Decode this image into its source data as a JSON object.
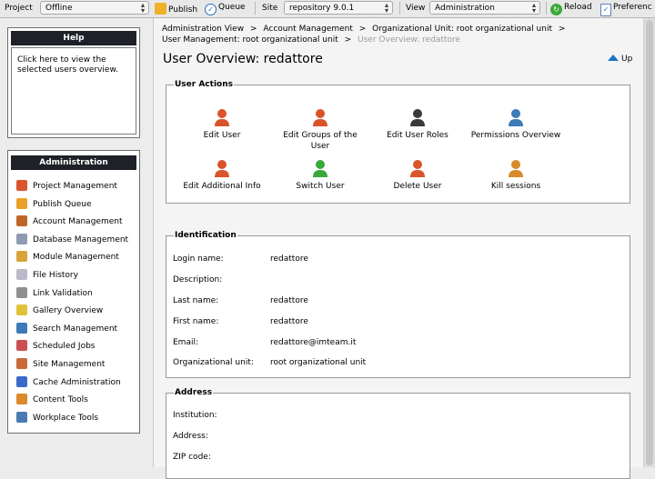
{
  "toolbar": {
    "project_label": "Project",
    "project_value": "Offline",
    "publish_label": "Publish",
    "queue_label": "Queue",
    "site_label": "Site",
    "site_value": "repository 9.0.1",
    "view_label": "View",
    "view_value": "Administration",
    "reload_label": "Reload",
    "preferences_label": "Preferenc"
  },
  "help": {
    "title": "Help",
    "text": "Click here to view the selected users overview."
  },
  "admin": {
    "title": "Administration",
    "items": [
      {
        "label": "Project Management",
        "icon": "project-management-icon",
        "color": "#d9542b"
      },
      {
        "label": "Publish Queue",
        "icon": "publish-queue-icon",
        "color": "#e8a22a"
      },
      {
        "label": "Account Management",
        "icon": "account-management-icon",
        "color": "#c0652a"
      },
      {
        "label": "Database Management",
        "icon": "database-management-icon",
        "color": "#8f9bb3"
      },
      {
        "label": "Module Management",
        "icon": "module-management-icon",
        "color": "#d9a23a"
      },
      {
        "label": "File History",
        "icon": "file-history-icon",
        "color": "#b9b9c8"
      },
      {
        "label": "Link Validation",
        "icon": "link-validation-icon",
        "color": "#8f8f8f"
      },
      {
        "label": "Gallery Overview",
        "icon": "gallery-overview-icon",
        "color": "#e0c23a"
      },
      {
        "label": "Search Management",
        "icon": "search-management-icon",
        "color": "#3d7ab8"
      },
      {
        "label": "Scheduled Jobs",
        "icon": "scheduled-jobs-icon",
        "color": "#c95050"
      },
      {
        "label": "Site Management",
        "icon": "site-management-icon",
        "color": "#c96a3a"
      },
      {
        "label": "Cache Administration",
        "icon": "cache-administration-icon",
        "color": "#3a6ac9"
      },
      {
        "label": "Content Tools",
        "icon": "content-tools-icon",
        "color": "#d98a2a"
      },
      {
        "label": "Workplace Tools",
        "icon": "workplace-tools-icon",
        "color": "#4a7ab0"
      }
    ]
  },
  "breadcrumb": {
    "items": [
      "Administration View",
      "Account Management",
      "Organizational Unit: root organizational unit",
      "User Management: root organizational unit"
    ],
    "current": "User Overview: redattore",
    "separator": ">"
  },
  "page": {
    "title": "User Overview: redattore",
    "up_label": "Up"
  },
  "user_actions": {
    "legend": "User Actions",
    "items": [
      {
        "label": "Edit User",
        "icon": "edit-user-icon"
      },
      {
        "label": "Edit Groups of the User",
        "icon": "edit-groups-icon"
      },
      {
        "label": "Edit User Roles",
        "icon": "edit-user-roles-icon"
      },
      {
        "label": "Permissions Overview",
        "icon": "permissions-overview-icon"
      },
      {
        "label": "Edit Additional Info",
        "icon": "edit-additional-info-icon"
      },
      {
        "label": "Switch User",
        "icon": "switch-user-icon"
      },
      {
        "label": "Delete User",
        "icon": "delete-user-icon"
      },
      {
        "label": "Kill sessions",
        "icon": "kill-sessions-icon"
      }
    ]
  },
  "identification": {
    "legend": "Identification",
    "fields": [
      {
        "label": "Login name:",
        "value": "redattore"
      },
      {
        "label": "Description:",
        "value": ""
      },
      {
        "label": "Last name:",
        "value": "redattore"
      },
      {
        "label": "First name:",
        "value": "redattore"
      },
      {
        "label": "Email:",
        "value": "redattore@imteam.it"
      },
      {
        "label": "Organizational unit:",
        "value": "root organizational unit"
      }
    ]
  },
  "address": {
    "legend": "Address",
    "fields": [
      {
        "label": "Institution:",
        "value": ""
      },
      {
        "label": "Address:",
        "value": ""
      },
      {
        "label": "ZIP code:",
        "value": ""
      }
    ]
  }
}
